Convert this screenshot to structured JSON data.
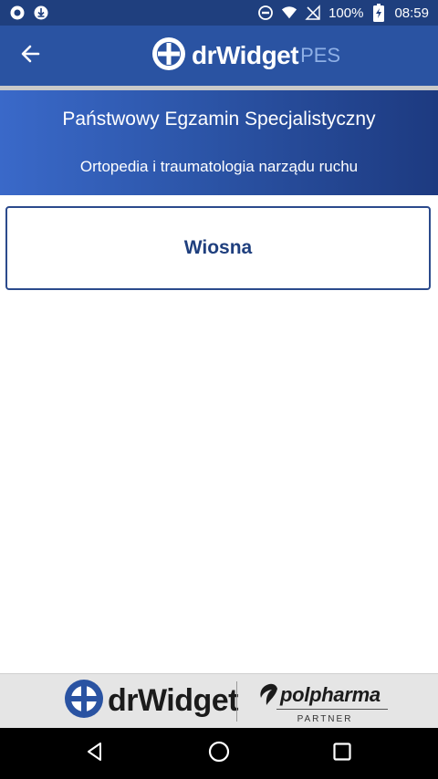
{
  "status_bar": {
    "battery": "100%",
    "time": "08:59",
    "icons": [
      "notification-circle-icon",
      "download-icon",
      "do-not-disturb-icon",
      "wifi-icon",
      "no-signal-icon",
      "battery-charging-icon"
    ]
  },
  "app_bar": {
    "back_icon": "arrow-back-icon",
    "logo_text": "drWidget",
    "logo_suffix": "PES",
    "background": "#2a53a2"
  },
  "exam": {
    "title": "Państwowy Egzamin Specjalistyczny",
    "subtitle": "Ortopedia i traumatologia narządu ruchu"
  },
  "sessions": [
    {
      "label": "Wiosna"
    }
  ],
  "footer": {
    "logo_text": "drWidget",
    "partner_name": "polpharma",
    "partner_caption": "PARTNER"
  },
  "nav_bar": {
    "buttons": [
      "back-triangle-icon",
      "home-circle-icon",
      "recents-square-icon"
    ]
  },
  "colors": {
    "primary": "#2a53a2",
    "primary_dark": "#1f3f7e",
    "card_border": "#2b4a8c",
    "footer_bg": "#e5e5e5"
  }
}
